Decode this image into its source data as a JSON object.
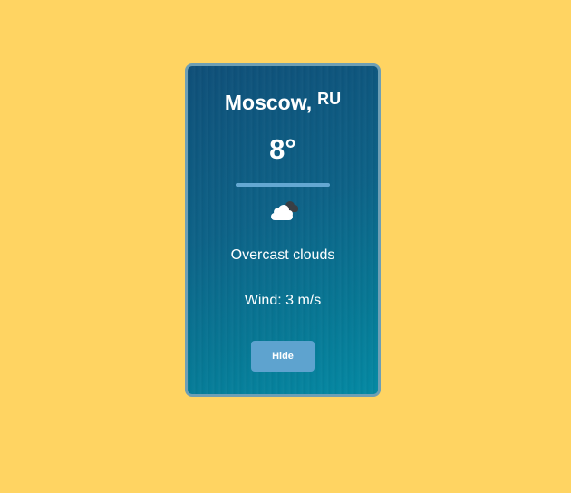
{
  "weather": {
    "city": "Moscow,",
    "country": "RU",
    "temperature": "8°",
    "description": "Overcast clouds",
    "wind": "Wind: 3 m/s",
    "icon": "overcast-clouds-icon"
  },
  "actions": {
    "hide_label": "Hide"
  },
  "colors": {
    "page_background": "#ffd462",
    "card_gradient_start": "#0f4f78",
    "card_gradient_end": "#0489a3",
    "button": "#5ea3cf",
    "divider": "#64a8d2"
  }
}
